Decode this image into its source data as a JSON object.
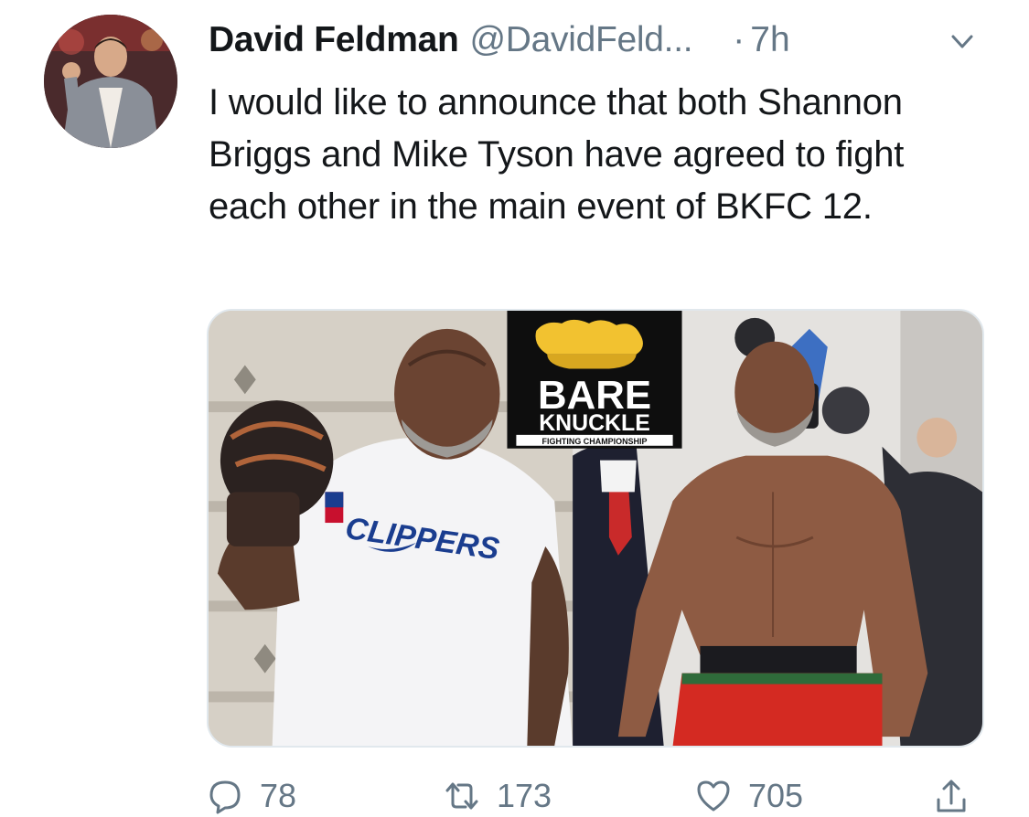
{
  "tweet": {
    "display_name": "David Feldman",
    "handle": "@DavidFeld...",
    "separator": "·",
    "time": "7h",
    "text": "I would like to announce that both Shannon Briggs and Mike Tyson have agreed to fight each other in the main event of BKFC 12.",
    "media": {
      "logo_line1": "BARE",
      "logo_line2": "KNUCKLE",
      "logo_line3": "FIGHTING CHAMPIONSHIP",
      "shirt_text": "CLIPPERS"
    },
    "actions": {
      "reply_icon": "reply-icon",
      "reply_count": "78",
      "retweet_icon": "retweet-icon",
      "retweet_count": "173",
      "like_icon": "heart-icon",
      "like_count": "705",
      "share_icon": "share-icon"
    }
  },
  "colors": {
    "text": "#14171a",
    "secondary": "#657786",
    "logo_gold": "#f2c230",
    "shorts_red": "#d42a22"
  }
}
